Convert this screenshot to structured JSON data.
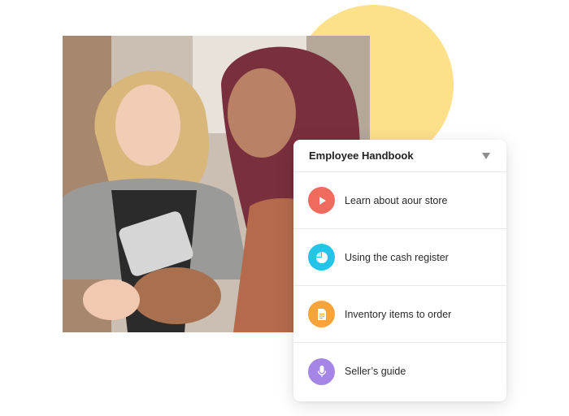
{
  "card": {
    "title": "Employee Handbook",
    "items": [
      {
        "label": "Learn about aour store",
        "icon": "play-icon",
        "color": "#f06a5e"
      },
      {
        "label": "Using the cash register",
        "icon": "pie-chart-icon",
        "color": "#22c4e8"
      },
      {
        "label": "Inventory items to order",
        "icon": "document-icon",
        "color": "#f9a43b"
      },
      {
        "label": "Seller’s guide",
        "icon": "microphone-icon",
        "color": "#a585e6"
      }
    ]
  },
  "colors": {
    "accent_circle": "#fde08a"
  }
}
